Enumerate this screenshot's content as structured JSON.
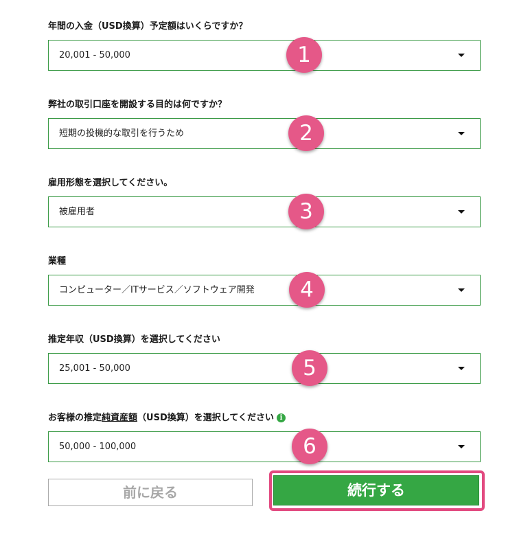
{
  "questions": [
    {
      "label": "年間の入金（USD換算）予定額はいくらですか？",
      "value": "20,001 - 50,000",
      "step": "1"
    },
    {
      "label": "弊社の取引口座を開設する目的は何ですか？",
      "value": "短期の投機的な取引を行うため",
      "step": "2"
    },
    {
      "label": "雇用形態を選択してください。",
      "value": "被雇用者",
      "step": "3"
    },
    {
      "label": "業種",
      "value": "コンピューター／ITサービス／ソフトウェア開発",
      "step": "4"
    },
    {
      "label": "推定年収（USD換算）を選択してください",
      "value": "25,001 - 50,000",
      "step": "5"
    },
    {
      "label_prefix": "お客様の推定",
      "label_link": "純資産額",
      "label_suffix": "（USD換算）を選択してください",
      "value": "50,000 - 100,000",
      "step": "6",
      "info_icon": "i"
    }
  ],
  "buttons": {
    "back_label": "前に戻る",
    "continue_label": "続行する"
  },
  "colors": {
    "accent_green": "#35a744",
    "border_green": "#3a9a45",
    "badge_pink": "#e55888",
    "highlight_pink": "#e24a80"
  }
}
